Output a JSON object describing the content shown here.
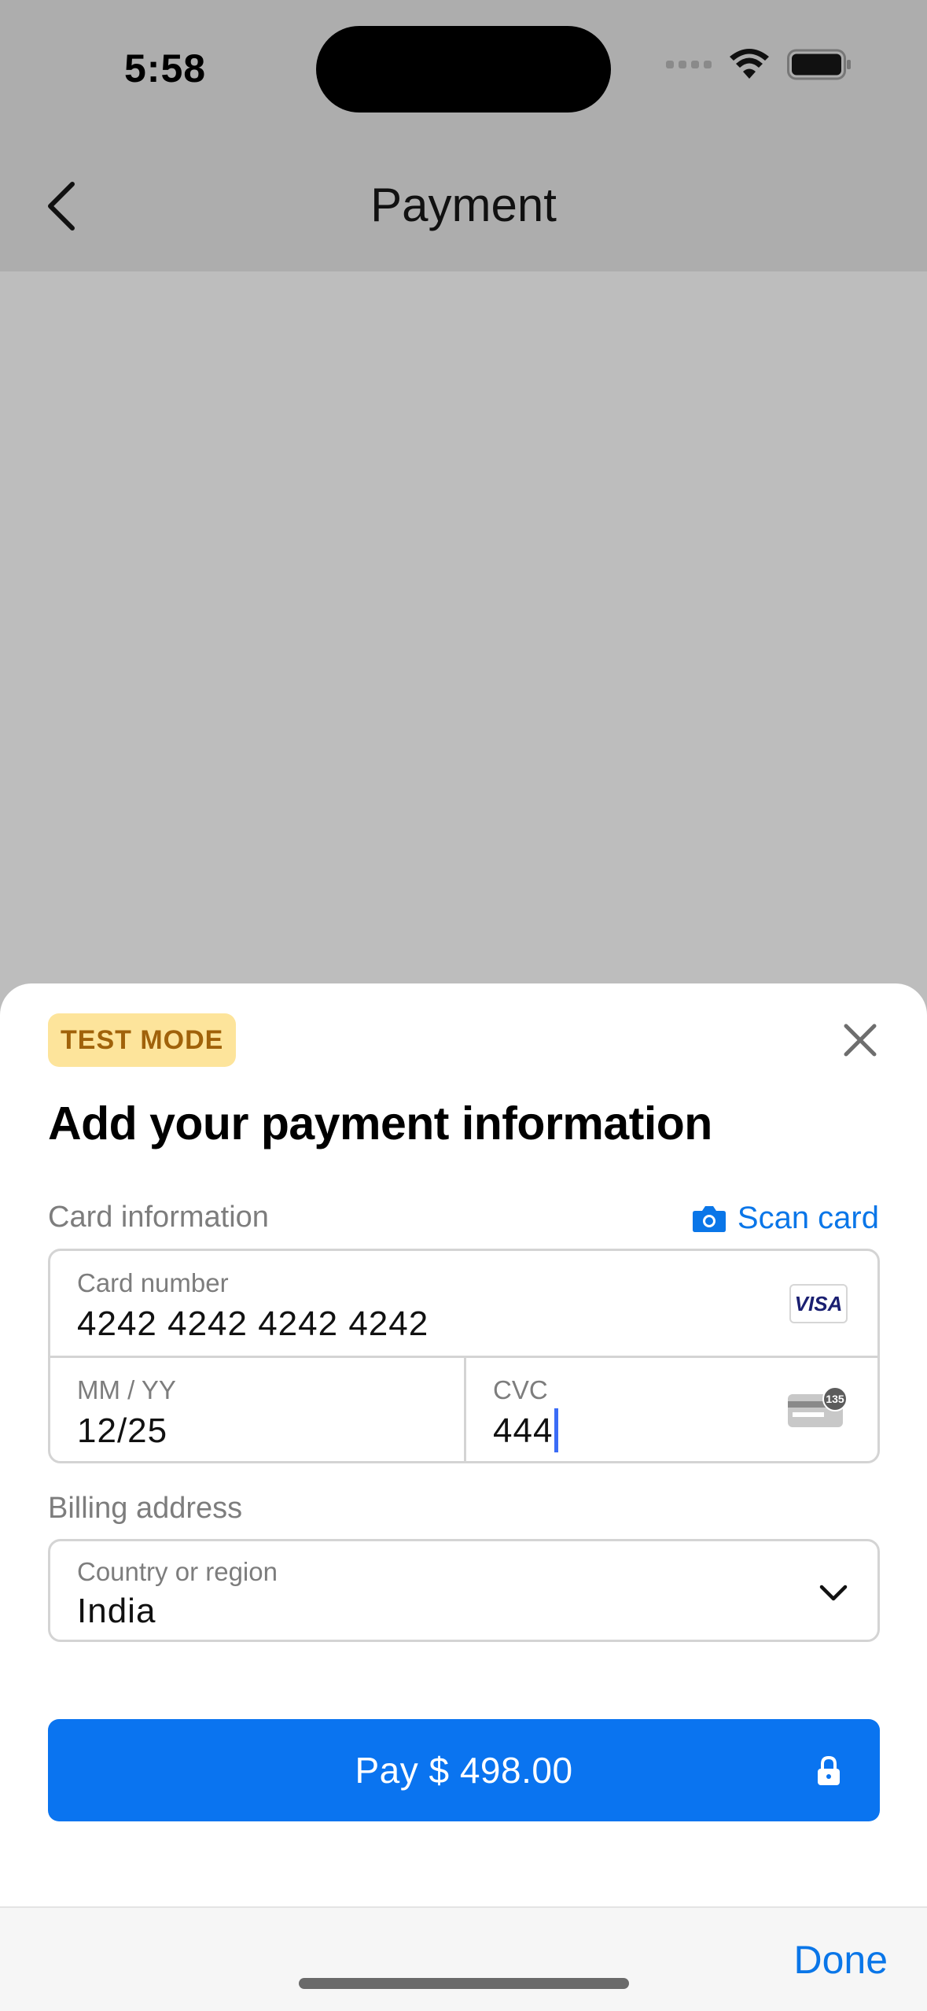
{
  "status_bar": {
    "time": "5:58"
  },
  "nav": {
    "title": "Payment"
  },
  "sheet": {
    "badge": "TEST MODE",
    "heading": "Add your payment information",
    "card_section_label": "Card information",
    "scan_card_label": "Scan card",
    "card_number": {
      "label": "Card number",
      "value": "4242 4242 4242 4242",
      "brand": "VISA"
    },
    "expiry": {
      "label": "MM / YY",
      "value": "12/25"
    },
    "cvc": {
      "label": "CVC",
      "value": "444",
      "icon_badge": "135"
    },
    "billing_section_label": "Billing address",
    "country": {
      "label": "Country or region",
      "value": "India"
    },
    "pay_button_label": "Pay $ 498.00"
  },
  "bottom_bar": {
    "done_label": "Done"
  },
  "colors": {
    "accent": "#0a74f0",
    "badge_bg": "#fde49b",
    "badge_text": "#a0620a"
  }
}
